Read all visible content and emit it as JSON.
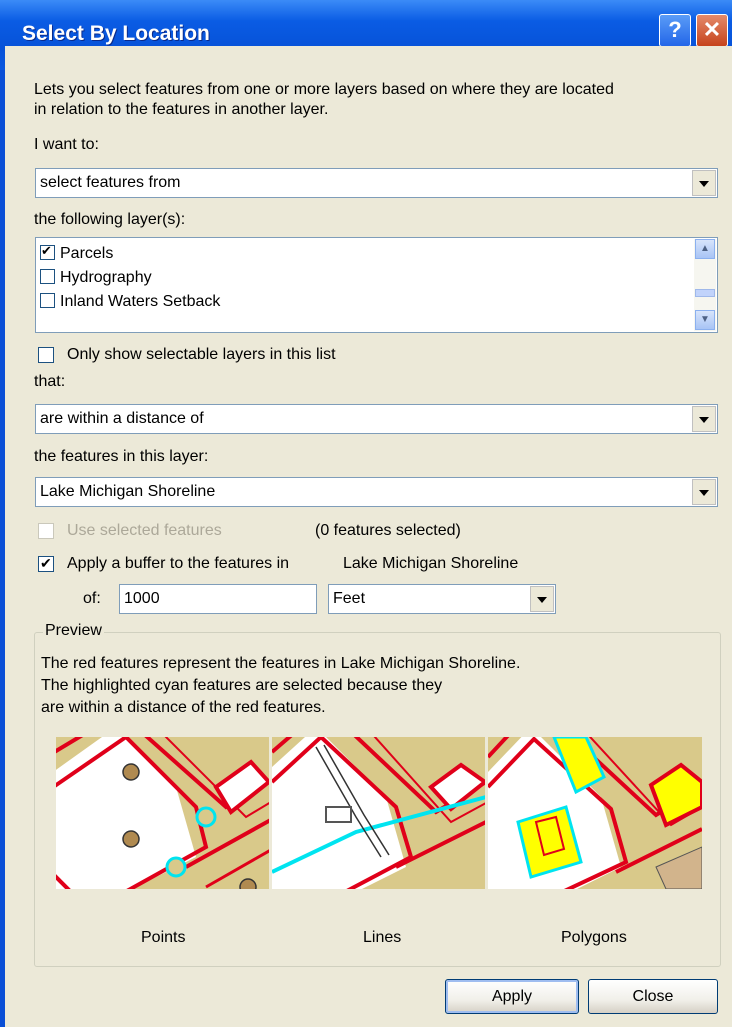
{
  "window": {
    "title": "Select By Location",
    "help_label": "?",
    "close_label": "✕"
  },
  "intro": {
    "line1": "Lets you select features from one or more layers based on where they are located",
    "line2": "in relation to the features in another layer."
  },
  "method": {
    "label": "I want to:",
    "value": "select features from"
  },
  "target_layers": {
    "label": "the following layer(s):",
    "items": [
      {
        "label": "Parcels",
        "checked": true
      },
      {
        "label": "Hydrography",
        "checked": false
      },
      {
        "label": "Inland Waters Setback",
        "checked": false
      }
    ]
  },
  "only_selectable": {
    "label": "Only show selectable layers in this list",
    "checked": false
  },
  "relation": {
    "label": "that:",
    "value": "are within a distance of"
  },
  "source_layer": {
    "label": "the features in this layer:",
    "value": "Lake Michigan Shoreline"
  },
  "use_selected": {
    "label": "Use selected features",
    "count_text": "(0 features selected)",
    "checked": false,
    "enabled": false
  },
  "buffer": {
    "label": "Apply a buffer to the features in",
    "layer_name": "Lake Michigan Shoreline",
    "checked": true,
    "of_label": "of:",
    "distance": "1000",
    "units": "Feet"
  },
  "preview": {
    "legend": "Preview",
    "line1": "The red features represent the features in Lake Michigan Shoreline.",
    "line2": "The highlighted cyan features are selected because they",
    "line3": "are within a distance of the red features.",
    "captions": [
      "Points",
      "Lines",
      "Polygons"
    ]
  },
  "buttons": {
    "apply": "Apply",
    "close": "Close"
  },
  "colors": {
    "red_feature": "#e0001a",
    "cyan_selected": "#00e4f0",
    "parcel_fill": "#d9c98a",
    "polygon_selected": "#ffff00"
  }
}
